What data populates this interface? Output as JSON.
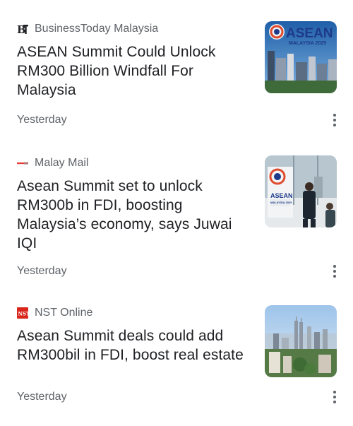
{
  "feed": {
    "articles": [
      {
        "source": "BusinessToday Malaysia",
        "source_logo_icon": "businesstoday-logo-icon",
        "headline": "ASEAN Summit Could Unlock RM300 Billion Windfall For Malaysia",
        "time": "Yesterday",
        "thumbnail_text": [
          "ASEAN",
          "MALAYSIA 2025"
        ]
      },
      {
        "source": "Malay Mail",
        "source_logo_icon": "malay-mail-logo-icon",
        "headline": "Asean Summit set to unlock RM300b in FDI, boosting Malaysia’s economy, says Juwai IQI",
        "time": "Yesterday",
        "thumbnail_text": [
          "ASEAN",
          "MALAYSIA 2025"
        ]
      },
      {
        "source": "NST Online",
        "source_logo_icon": "nst-logo-icon",
        "headline": "Asean Summit deals could add RM300bil in FDI, boost real estate",
        "time": "Yesterday"
      }
    ]
  },
  "colors": {
    "headline": "#202124",
    "secondary_text": "#5f6368",
    "nst_red": "#d9261c",
    "malaymail_red": "#e53935",
    "asean_blue": "#1e3a8a"
  }
}
